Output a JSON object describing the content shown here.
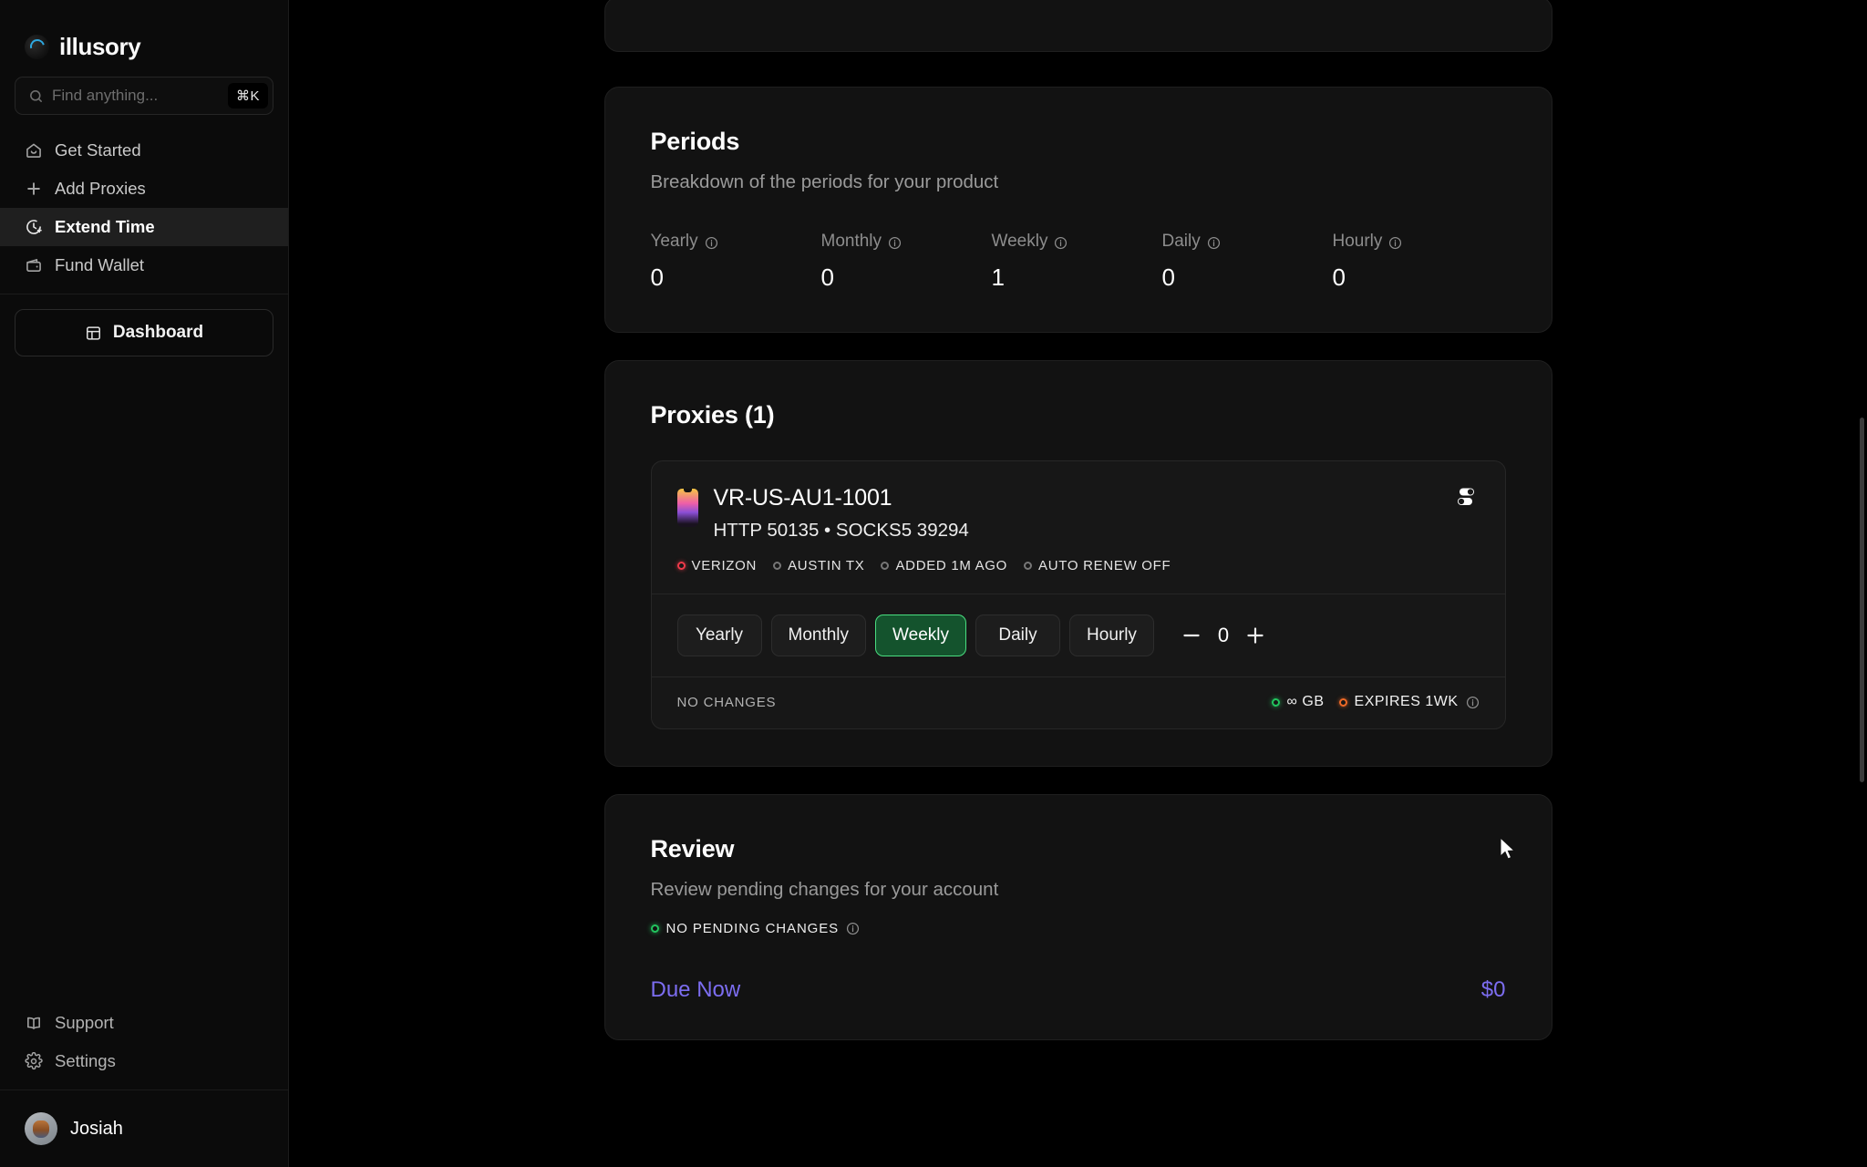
{
  "sidebar": {
    "brand": {
      "name": "illusory",
      "logo_icon": "illusory-logo-icon"
    },
    "search": {
      "placeholder": "Find anything...",
      "shortcut": "⌘K",
      "icon": "search-icon"
    },
    "nav_items": [
      {
        "label": "Get Started",
        "icon": "home-icon",
        "active": false
      },
      {
        "label": "Add Proxies",
        "icon": "plus-icon",
        "active": false
      },
      {
        "label": "Extend Time",
        "icon": "clock-plus-icon",
        "active": true
      },
      {
        "label": "Fund Wallet",
        "icon": "wallet-icon",
        "active": false
      }
    ],
    "dashboard_button": {
      "label": "Dashboard",
      "icon": "layout-dashboard-icon"
    },
    "bottom_items": [
      {
        "label": "Support",
        "icon": "book-open-icon"
      },
      {
        "label": "Settings",
        "icon": "gear-icon"
      }
    ],
    "user": {
      "name": "Josiah",
      "avatar_icon": "avatar"
    }
  },
  "main": {
    "periods_card": {
      "title": "Periods",
      "subtitle": "Breakdown of the periods for your product",
      "stats": [
        {
          "label": "Yearly",
          "value": "0"
        },
        {
          "label": "Monthly",
          "value": "0"
        },
        {
          "label": "Weekly",
          "value": "1"
        },
        {
          "label": "Daily",
          "value": "0"
        },
        {
          "label": "Hourly",
          "value": "0"
        }
      ]
    },
    "proxies_card": {
      "title": "Proxies (1)",
      "proxy": {
        "name": "VR-US-AU1-1001",
        "ports": "HTTP 50135 • SOCKS5 39294",
        "device_icon": "phone-icon",
        "settings_icon": "toggles-icon",
        "tags": [
          {
            "label": "VERIZON",
            "dot": "red"
          },
          {
            "label": "AUSTIN TX",
            "dot": "gray"
          },
          {
            "label": "ADDED 1M AGO",
            "dot": "gray"
          },
          {
            "label": "AUTO RENEW OFF",
            "dot": "gray"
          }
        ],
        "period_buttons": [
          {
            "label": "Yearly",
            "selected": false
          },
          {
            "label": "Monthly",
            "selected": false
          },
          {
            "label": "Weekly",
            "selected": true
          },
          {
            "label": "Daily",
            "selected": false
          },
          {
            "label": "Hourly",
            "selected": false
          }
        ],
        "stepper": {
          "decrement": "−",
          "value": "0",
          "increment": "+"
        },
        "footer": {
          "status": "NO CHANGES",
          "bandwidth": "∞ GB",
          "bandwidth_dot": "green",
          "expires": "EXPIRES 1WK",
          "expires_dot": "orange",
          "info_icon": "info-icon"
        }
      }
    },
    "review_card": {
      "title": "Review",
      "subtitle": "Review pending changes for your account",
      "pending_status": "NO PENDING CHANGES",
      "pending_dot": "green",
      "due_label": "Due Now",
      "due_value": "$0"
    }
  },
  "colors": {
    "accent_purple": "#7c6df0",
    "selected_green_bg": "#14532d",
    "selected_green_border": "#4ade80",
    "status_green": "#22c55e",
    "status_orange": "#f06a27",
    "status_red": "#f03a4a",
    "brand_blue": "#2ea8e0"
  }
}
